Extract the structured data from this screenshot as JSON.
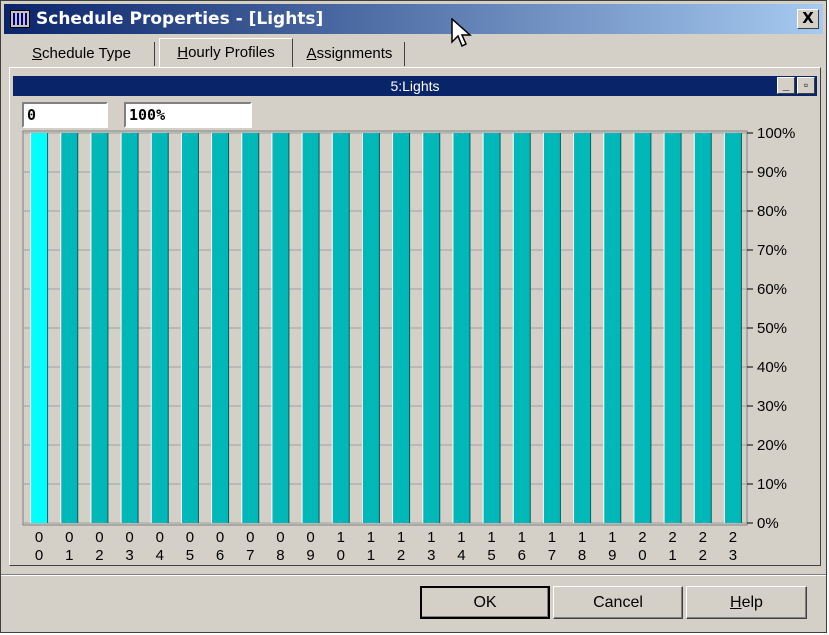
{
  "window": {
    "title": "Schedule Properties - [Lights]",
    "close_label": "X"
  },
  "tabs": [
    {
      "label": "Schedule Type",
      "mnemonic": "S",
      "rest": "chedule Type",
      "active": false
    },
    {
      "label": "Hourly Profiles",
      "mnemonic": "H",
      "rest": "ourly Profiles",
      "active": true
    },
    {
      "label": "Assignments",
      "mnemonic": "A",
      "rest": "ssignments",
      "active": false
    }
  ],
  "profile": {
    "title": "5:Lights",
    "min_value": "0",
    "max_value": "100%",
    "minimize_label": "_",
    "restore_label": "▫"
  },
  "chart_data": {
    "type": "bar",
    "title": "5:Lights",
    "categories": [
      "00",
      "01",
      "02",
      "03",
      "04",
      "05",
      "06",
      "07",
      "08",
      "09",
      "10",
      "11",
      "12",
      "13",
      "14",
      "15",
      "16",
      "17",
      "18",
      "19",
      "20",
      "21",
      "22",
      "23"
    ],
    "values": [
      100,
      100,
      100,
      100,
      100,
      100,
      100,
      100,
      100,
      100,
      100,
      100,
      100,
      100,
      100,
      100,
      100,
      100,
      100,
      100,
      100,
      100,
      100,
      100
    ],
    "ylim": [
      0,
      100
    ],
    "y_ticks": [
      "0%",
      "10%",
      "20%",
      "30%",
      "40%",
      "50%",
      "60%",
      "70%",
      "80%",
      "90%",
      "100%"
    ],
    "grid": true,
    "selected_index": 0,
    "colors": {
      "bar": "#00b8b8",
      "bar_selected": "#00ffff",
      "background": "#d4d0c8",
      "grid": "#a0a0a0"
    }
  },
  "buttons": {
    "ok": "OK",
    "cancel": "Cancel",
    "help_mnemonic": "H",
    "help_rest": "elp"
  }
}
